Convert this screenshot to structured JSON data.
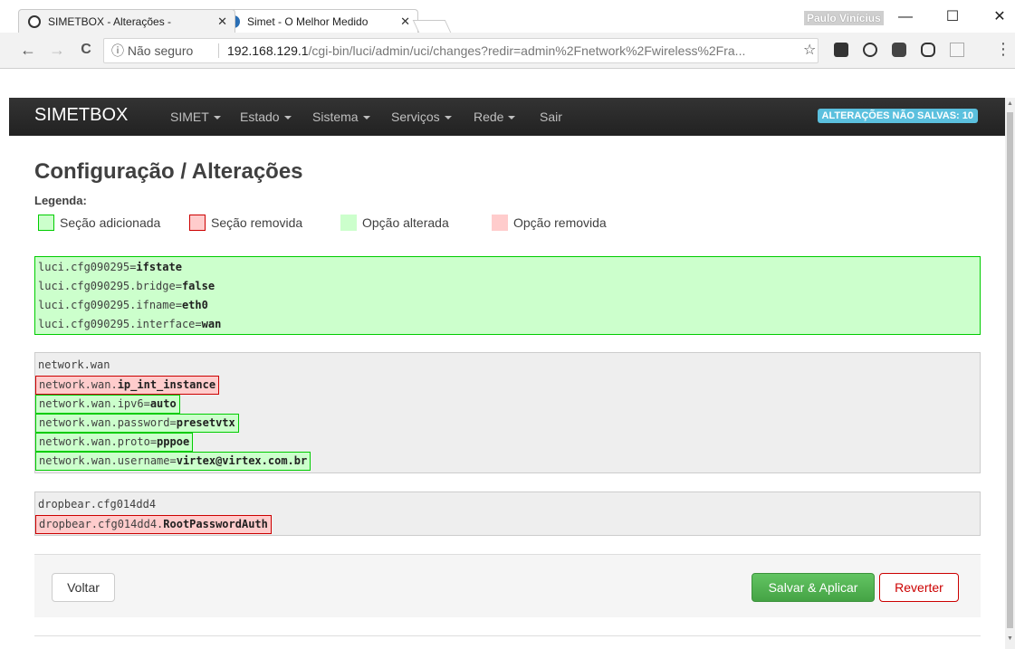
{
  "browser": {
    "tabs": [
      {
        "title": "SIMETBOX - Alterações - ",
        "close": "✕"
      },
      {
        "title": "Simet - O Melhor Medido",
        "close": "✕"
      }
    ],
    "user": "Paulo Vinícius",
    "window_controls": {
      "minimize": "—",
      "maximize": "☐",
      "close": "✕"
    },
    "nav": {
      "back": "←",
      "forward": "→",
      "reload": "C"
    },
    "secure_label": "ⓘ Não seguro",
    "url_host": "192.168.129.1",
    "url_path": "/cgi-bin/luci/admin/uci/changes?redir=admin%2Fnetwork%2Fwireless%2Fra...",
    "star": "☆",
    "menu": "⋮"
  },
  "navbar": {
    "brand": "SIMETBOX",
    "items": [
      {
        "label": "SIMET",
        "dropdown": true
      },
      {
        "label": "Estado",
        "dropdown": true
      },
      {
        "label": "Sistema",
        "dropdown": true
      },
      {
        "label": "Serviços",
        "dropdown": true
      },
      {
        "label": "Rede",
        "dropdown": true
      },
      {
        "label": "Sair",
        "dropdown": false
      }
    ],
    "unsaved_badge": "ALTERAÇÕES NÃO SALVAS: 10"
  },
  "page": {
    "title": "Configuração / Alterações",
    "legend_title": "Legenda:",
    "legend": [
      {
        "label": "Seção adicionada",
        "color": "#ccffcc",
        "border": "#00cc00"
      },
      {
        "label": "Seção removida",
        "color": "#ffcccc",
        "border": "#cc0000"
      },
      {
        "label": "Opção alterada",
        "color": "#ccffcc",
        "border": "#ccffcc"
      },
      {
        "label": "Opção removida",
        "color": "#ffcccc",
        "border": "#ffcccc"
      }
    ]
  },
  "changes": [
    {
      "kind": "added-section",
      "lines": [
        {
          "prefix": "luci.cfg090295=",
          "value": "ifstate"
        },
        {
          "prefix": "luci.cfg090295.bridge=",
          "value": "false"
        },
        {
          "prefix": "luci.cfg090295.ifname=",
          "value": "eth0"
        },
        {
          "prefix": "luci.cfg090295.interface=",
          "value": "wan"
        }
      ]
    },
    {
      "kind": "normal-section",
      "lines": [
        {
          "prefix": "network.wan",
          "value": "",
          "state": "plain"
        },
        {
          "prefix": "network.wan.",
          "value": "ip_int_instance",
          "state": "removed"
        },
        {
          "prefix": "network.wan.ipv6=",
          "value": "auto",
          "state": "added"
        },
        {
          "prefix": "network.wan.password=",
          "value": "presetvtx",
          "state": "added"
        },
        {
          "prefix": "network.wan.proto=",
          "value": "pppoe",
          "state": "added"
        },
        {
          "prefix": "network.wan.username=",
          "value": "virtex@virtex.com.br",
          "state": "added"
        }
      ]
    },
    {
      "kind": "normal-section",
      "lines": [
        {
          "prefix": "dropbear.cfg014dd4",
          "value": "",
          "state": "plain"
        },
        {
          "prefix": "dropbear.cfg014dd4.",
          "value": "RootPasswordAuth",
          "state": "removed"
        }
      ]
    }
  ],
  "actions": {
    "back": "Voltar",
    "apply": "Salvar & Aplicar",
    "revert": "Reverter"
  }
}
